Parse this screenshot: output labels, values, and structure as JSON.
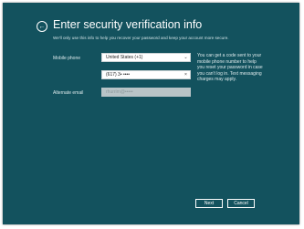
{
  "header": {
    "back_icon": "arrow-left-circle-icon",
    "title": "Enter security verification info",
    "subtitle": "We'll only use this info to help you recover your password and keep your account more secure."
  },
  "form": {
    "mobile_phone_label": "Mobile phone",
    "country_value": "United States (+1)",
    "phone_value": "(617) 3• ••••",
    "clear_icon": "close-icon",
    "alternate_email_label": "Alternate email",
    "alternate_email_value": "rhurrim@•••••"
  },
  "help_text": "You can get a code sent to your mobile phone number to help you reset your password in case you can't log in. Text messaging charges may apply.",
  "buttons": {
    "next_label": "Next",
    "cancel_label": "Cancel"
  },
  "colors": {
    "background": "#13525e",
    "text": "#ffffff"
  }
}
